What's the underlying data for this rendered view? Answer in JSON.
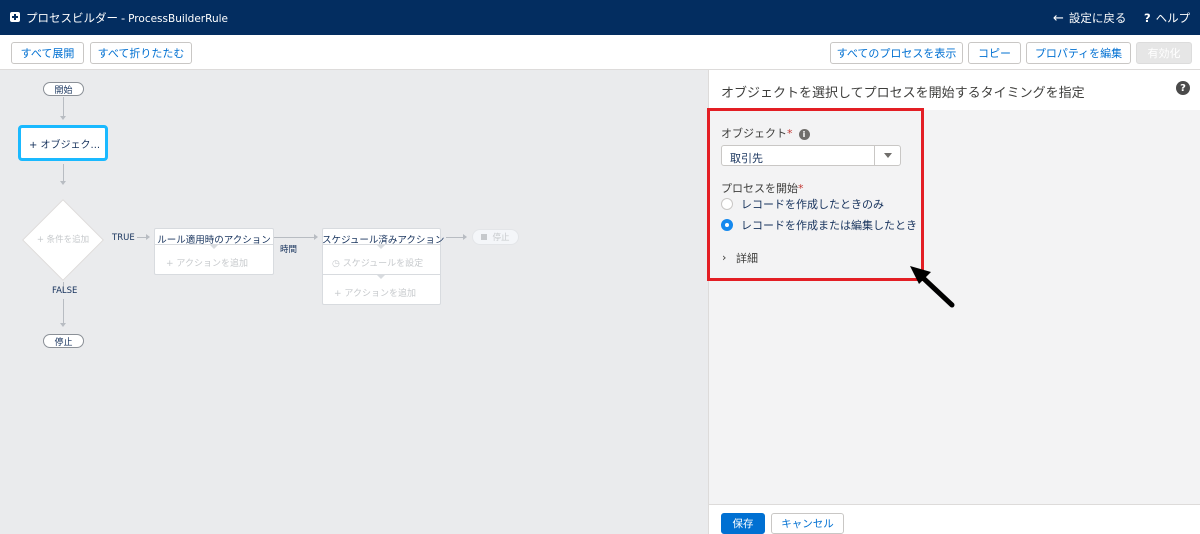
{
  "header": {
    "app_name": "プロセスビルダー",
    "separator": "-",
    "process_name": "ProcessBuilderRule",
    "back_label": "設定に戻る",
    "help_label": "ヘルプ"
  },
  "toolbar": {
    "expand_all": "すべて展開",
    "collapse_all": "すべて折りたたむ",
    "show_all_processes": "すべてのプロセスを表示",
    "copy": "コピー",
    "edit_properties": "プロパティを編集",
    "activate": "有効化"
  },
  "canvas": {
    "start_label": "開始",
    "object_node_label": "+ オブジェク...",
    "criteria_label": "+ 条件を追加",
    "true_label": "TRUE",
    "false_label": "FALSE",
    "stop_label": "停止",
    "immediate_actions_title": "ルール適用時のアクション",
    "add_action_label": "+ アクションを追加",
    "time_label": "時間",
    "scheduled_actions_title": "スケジュール済みアクション",
    "set_schedule_label": "スケジュールを設定",
    "stop2_label": "停止"
  },
  "panel": {
    "title": "オブジェクトを選択してプロセスを開始するタイミングを指定",
    "object_label": "オブジェクト",
    "required_mark": "*",
    "object_value": "取引先",
    "start_process_label": "プロセスを開始",
    "radio_options": [
      {
        "label": "レコードを作成したときのみ",
        "checked": false
      },
      {
        "label": "レコードを作成または編集したとき",
        "checked": true
      }
    ],
    "details_label": "詳細",
    "save_label": "保存",
    "cancel_label": "キャンセル"
  },
  "colors": {
    "header_bg": "#032d60",
    "brand_blue": "#0070d2",
    "highlight_red": "#e31e24",
    "selected_node_border": "#1ab9ff"
  },
  "icons": [
    "process-builder-icon",
    "back-arrow-icon",
    "help-icon",
    "info-icon",
    "dropdown-chevron-icon",
    "clock-icon",
    "stop-icon",
    "details-chevron-icon"
  ]
}
